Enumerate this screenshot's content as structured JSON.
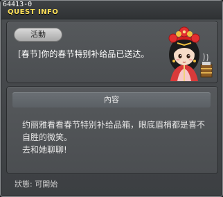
{
  "window": {
    "quest_id": "64413-0",
    "title": "QUEST INFO"
  },
  "summary": {
    "badge": "活動",
    "notice": "[春节]你的春节特别补给品已送达。"
  },
  "content": {
    "header": "內容",
    "lines": [
      "约丽雅看看春节特别补给品箱，眼底眉梢都是喜不",
      "自胜的微笑。",
      "去和她聊聊!"
    ]
  },
  "status": {
    "text": "狀態:  可開始"
  }
}
